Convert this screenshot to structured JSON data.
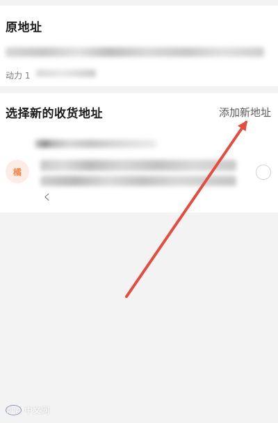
{
  "original_address": {
    "title": "原地址",
    "name_prefix": "动力 1"
  },
  "new_address_section": {
    "title": "选择新的收货地址",
    "add_button_label": "添加新地址"
  },
  "address_option": {
    "avatar_text": "橘",
    "tail_text": "く"
  },
  "watermark": {
    "logo_text": "php",
    "label": "中文网"
  },
  "colors": {
    "background": "#f3f3f3",
    "card": "#ffffff",
    "accent": "#f28b50",
    "annotation_arrow": "#e34c3f"
  }
}
